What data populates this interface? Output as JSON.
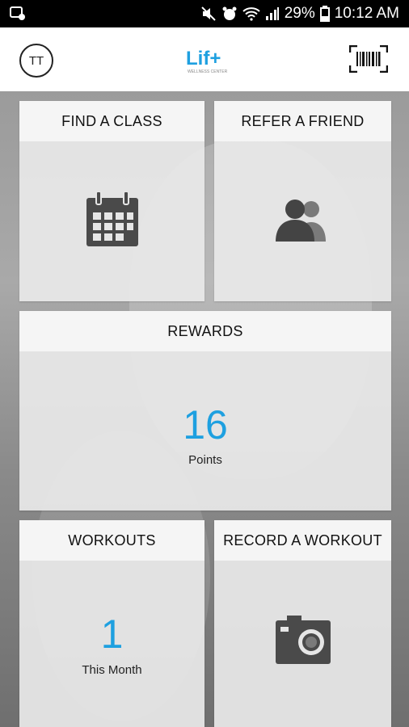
{
  "status_bar": {
    "battery": "29%",
    "time": "10:12 AM"
  },
  "header": {
    "avatar_initials": "TT",
    "logo_text": "Lif+",
    "logo_subtext": "WELLNESS CENTER"
  },
  "tiles": {
    "find_class": {
      "title": "FIND A CLASS",
      "icon": "calendar-icon"
    },
    "refer_friend": {
      "title": "REFER A FRIEND",
      "icon": "people-icon"
    },
    "rewards": {
      "title": "REWARDS",
      "value": "16",
      "unit": "Points"
    },
    "workouts": {
      "title": "WORKOUTS",
      "value": "1",
      "unit": "This Month"
    },
    "record_workout": {
      "title": "RECORD A WORKOUT",
      "icon": "camera-icon"
    }
  },
  "colors": {
    "accent": "#1ea0e0",
    "icon_dark": "#4a4a4a"
  }
}
